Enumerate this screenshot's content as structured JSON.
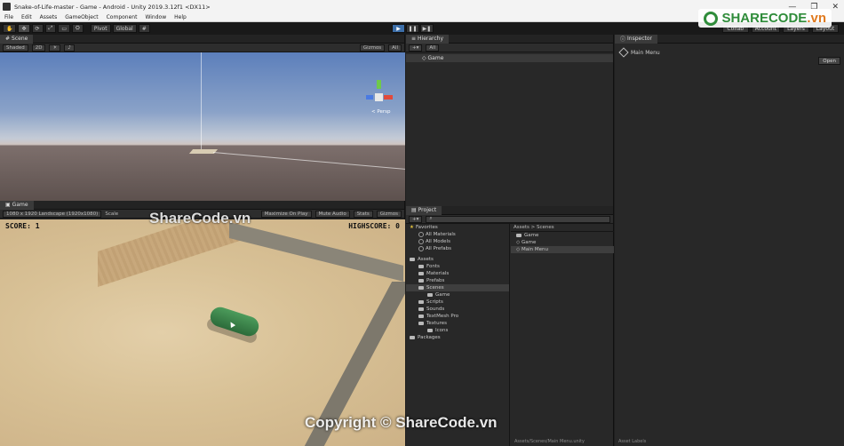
{
  "window": {
    "title": "Snake-of-Life-master - Game - Android - Unity 2019.3.12f1 <DX11>",
    "controls": [
      "—",
      "❐",
      "✕"
    ]
  },
  "menu": [
    "File",
    "Edit",
    "Assets",
    "GameObject",
    "Component",
    "Window",
    "Help"
  ],
  "toolbar": {
    "tools": [
      "✋",
      "✥",
      "⟳",
      "⤢",
      "▭",
      "⛭"
    ],
    "pivot_label": "Pivot",
    "global_label": "Global",
    "grid_label": "#",
    "right": [
      "Collab",
      "Account",
      "Layers",
      "Layout"
    ]
  },
  "scene": {
    "tab": "Scene",
    "shading": "Shaded",
    "mode_2d": "2D",
    "gizmos": "Gizmos",
    "search": "All",
    "persp_label": "< Persp"
  },
  "game": {
    "tab": "Game",
    "resolution": "1080 x 1920 Landscape (1920x1080)",
    "scale": "Scale",
    "maximize": "Maximize On Play",
    "mute": "Mute Audio",
    "stats": "Stats",
    "gizmos": "Gizmos",
    "score_text": "SCORE: 1",
    "highscore_text": "HIGHSCORE: 0"
  },
  "hierarchy": {
    "tab": "Hierarchy",
    "search": "All",
    "root": "Game"
  },
  "project": {
    "tab": "Project",
    "breadcrumb": "Assets > Scenes",
    "favorites_label": "Favorites",
    "favorites": [
      "All Materials",
      "All Models",
      "All Prefabs"
    ],
    "assets_label": "Assets",
    "folders": [
      "Fonts",
      "Materials",
      "Prefabs",
      "Scenes",
      "Game",
      "Scripts",
      "Sounds",
      "TextMesh Pro",
      "Textures",
      "Icons"
    ],
    "packages_label": "Packages",
    "files": [
      "Game",
      "Game",
      "Main Menu"
    ],
    "bottom": "Assets/Scenes/Main Menu.unity"
  },
  "inspector": {
    "tab": "Inspector",
    "object": "Main Menu",
    "open_label": "Open",
    "asset_labels": "Asset Labels"
  },
  "watermarks": {
    "top_prefix": "SHARECODE",
    "top_suffix": ".vn",
    "mid": "ShareCode.vn",
    "bottom": "Copyright © ShareCode.vn"
  }
}
